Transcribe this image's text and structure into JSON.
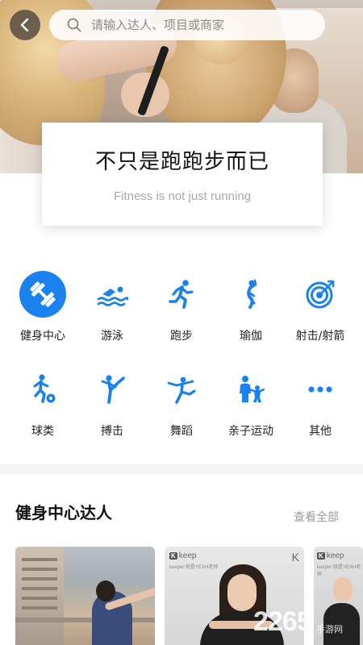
{
  "header": {
    "back_icon": "chevron-left-icon",
    "search_icon": "search-icon",
    "search_placeholder": "请输入达人、项目或商家"
  },
  "banner": {
    "title": "不只是跑跑步而已",
    "subtitle": "Fitness is not just running"
  },
  "categories": [
    {
      "label": "健身中心",
      "icon": "dumbbell-icon",
      "active": true
    },
    {
      "label": "游泳",
      "icon": "swimming-icon",
      "active": false
    },
    {
      "label": "跑步",
      "icon": "running-icon",
      "active": false
    },
    {
      "label": "瑜伽",
      "icon": "yoga-icon",
      "active": false
    },
    {
      "label": "射击/射箭",
      "icon": "target-icon",
      "active": false
    },
    {
      "label": "球类",
      "icon": "ball-sports-icon",
      "active": false
    },
    {
      "label": "搏击",
      "icon": "martial-arts-icon",
      "active": false
    },
    {
      "label": "舞蹈",
      "icon": "dance-icon",
      "active": false
    },
    {
      "label": "亲子运动",
      "icon": "parent-child-icon",
      "active": false
    },
    {
      "label": "其他",
      "icon": "more-icon",
      "active": false
    }
  ],
  "experts": {
    "title": "健身中心达人",
    "view_all": "查看全部",
    "cards": [
      {
        "brand": "",
        "caption": ""
      },
      {
        "brand": "keep",
        "caption": "keeper 就是YEAH老师"
      },
      {
        "brand": "keep",
        "caption": "keeper 就是YEAH老师"
      }
    ]
  },
  "watermark": {
    "text": "2265",
    "sub": "手游网"
  },
  "colors": {
    "accent": "#1a82ee",
    "text": "#1a1a1a",
    "muted": "#a9a9a9"
  }
}
